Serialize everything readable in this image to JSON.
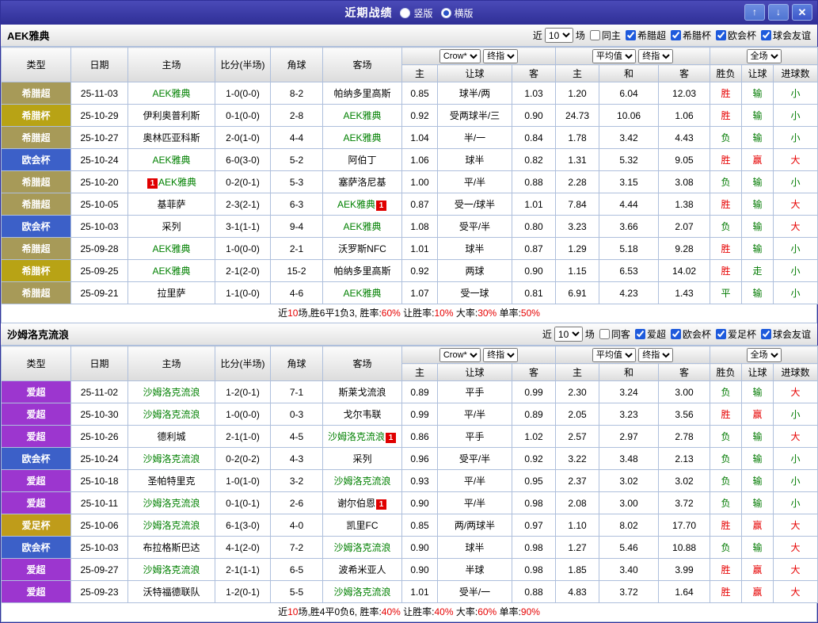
{
  "titlebar": {
    "title": "近期战绩",
    "radios": [
      {
        "label": "竖版",
        "selected": false
      },
      {
        "label": "横版",
        "selected": true
      }
    ],
    "icons": {
      "up": "↑",
      "down": "↓",
      "close": "✕"
    }
  },
  "colors": {
    "league": {
      "希腊超": "#a79a58",
      "希腊杯": "#b8a315",
      "欧会杯": "#3c60c8",
      "爱超": "#9c36cf",
      "爱足杯": "#bf9c1a"
    },
    "result": {
      "red": "#e60000",
      "green": "#007a00"
    }
  },
  "table_header": {
    "type": "类型",
    "date": "日期",
    "home": "主场",
    "score": "比分(半场)",
    "corner": "角球",
    "away": "客场",
    "crow_select": "Crow*",
    "final_select": "终指",
    "avg_select": "平均值",
    "final_select2": "终指",
    "scope_select": "全场",
    "h_home": "主",
    "h_handicap": "让球",
    "h_away": "客",
    "a_home": "主",
    "a_draw": "和",
    "a_away": "客",
    "r_result": "胜负",
    "r_handicap": "让球",
    "r_goals": "进球数"
  },
  "sections": [
    {
      "team": "AEK雅典",
      "filter": {
        "near": "近",
        "count": "10",
        "games": "场",
        "same": "同主",
        "same_checked": false,
        "leagues": [
          {
            "label": "希腊超",
            "checked": true
          },
          {
            "label": "希腊杯",
            "checked": true
          },
          {
            "label": "欧会杯",
            "checked": true
          },
          {
            "label": "球会友谊",
            "checked": true
          }
        ]
      },
      "rows": [
        {
          "lg": "希腊超",
          "dt": "25-11-03",
          "home": {
            "n": "AEK雅典",
            "g": 1
          },
          "sc": "1-0(0-0)",
          "cn": "8-2",
          "away": {
            "n": "帕纳多里高斯"
          },
          "odds": [
            "0.85",
            "球半/两",
            "1.03",
            "1.20",
            "6.04",
            "12.03"
          ],
          "res": [
            [
              "胜",
              "r"
            ],
            [
              "输",
              "g"
            ],
            [
              "小",
              "g"
            ]
          ]
        },
        {
          "lg": "希腊杯",
          "dt": "25-10-29",
          "home": {
            "n": "伊利奥普利斯"
          },
          "sc": "0-1(0-0)",
          "cn": "2-8",
          "away": {
            "n": "AEK雅典",
            "g": 1
          },
          "odds": [
            "0.92",
            "受两球半/三",
            "0.90",
            "24.73",
            "10.06",
            "1.06"
          ],
          "res": [
            [
              "胜",
              "r"
            ],
            [
              "输",
              "g"
            ],
            [
              "小",
              "g"
            ]
          ]
        },
        {
          "lg": "希腊超",
          "dt": "25-10-27",
          "home": {
            "n": "奥林匹亚科斯"
          },
          "sc": "2-0(1-0)",
          "cn": "4-4",
          "away": {
            "n": "AEK雅典",
            "g": 1
          },
          "odds": [
            "1.04",
            "半/一",
            "0.84",
            "1.78",
            "3.42",
            "4.43"
          ],
          "res": [
            [
              "负",
              "g"
            ],
            [
              "输",
              "g"
            ],
            [
              "小",
              "g"
            ]
          ]
        },
        {
          "lg": "欧会杯",
          "dt": "25-10-24",
          "home": {
            "n": "AEK雅典",
            "g": 1
          },
          "sc": "6-0(3-0)",
          "cn": "5-2",
          "away": {
            "n": "阿伯丁"
          },
          "odds": [
            "1.06",
            "球半",
            "0.82",
            "1.31",
            "5.32",
            "9.05"
          ],
          "res": [
            [
              "胜",
              "r"
            ],
            [
              "赢",
              "r"
            ],
            [
              "大",
              "r"
            ]
          ]
        },
        {
          "lg": "希腊超",
          "dt": "25-10-20",
          "home": {
            "n": "AEK雅典",
            "g": 1,
            "b": "1",
            "bp": "before"
          },
          "sc": "0-2(0-1)",
          "cn": "5-3",
          "away": {
            "n": "塞萨洛尼基"
          },
          "odds": [
            "1.00",
            "平/半",
            "0.88",
            "2.28",
            "3.15",
            "3.08"
          ],
          "res": [
            [
              "负",
              "g"
            ],
            [
              "输",
              "g"
            ],
            [
              "小",
              "g"
            ]
          ]
        },
        {
          "lg": "希腊超",
          "dt": "25-10-05",
          "home": {
            "n": "基菲萨"
          },
          "sc": "2-3(2-1)",
          "cn": "6-3",
          "away": {
            "n": "AEK雅典",
            "g": 1,
            "b": "1",
            "bp": "after"
          },
          "odds": [
            "0.87",
            "受一/球半",
            "1.01",
            "7.84",
            "4.44",
            "1.38"
          ],
          "res": [
            [
              "胜",
              "r"
            ],
            [
              "输",
              "g"
            ],
            [
              "大",
              "r"
            ]
          ]
        },
        {
          "lg": "欧会杯",
          "dt": "25-10-03",
          "home": {
            "n": "采列"
          },
          "sc": "3-1(1-1)",
          "cn": "9-4",
          "away": {
            "n": "AEK雅典",
            "g": 1
          },
          "odds": [
            "1.08",
            "受平/半",
            "0.80",
            "3.23",
            "3.66",
            "2.07"
          ],
          "res": [
            [
              "负",
              "g"
            ],
            [
              "输",
              "g"
            ],
            [
              "大",
              "r"
            ]
          ]
        },
        {
          "lg": "希腊超",
          "dt": "25-09-28",
          "home": {
            "n": "AEK雅典",
            "g": 1
          },
          "sc": "1-0(0-0)",
          "cn": "2-1",
          "away": {
            "n": "沃罗斯NFC"
          },
          "odds": [
            "1.01",
            "球半",
            "0.87",
            "1.29",
            "5.18",
            "9.28"
          ],
          "res": [
            [
              "胜",
              "r"
            ],
            [
              "输",
              "g"
            ],
            [
              "小",
              "g"
            ]
          ]
        },
        {
          "lg": "希腊杯",
          "dt": "25-09-25",
          "home": {
            "n": "AEK雅典",
            "g": 1
          },
          "sc": "2-1(2-0)",
          "cn": "15-2",
          "away": {
            "n": "帕纳多里高斯"
          },
          "odds": [
            "0.92",
            "两球",
            "0.90",
            "1.15",
            "6.53",
            "14.02"
          ],
          "res": [
            [
              "胜",
              "r"
            ],
            [
              "走",
              "g"
            ],
            [
              "小",
              "g"
            ]
          ]
        },
        {
          "lg": "希腊超",
          "dt": "25-09-21",
          "home": {
            "n": "拉里萨"
          },
          "sc": "1-1(0-0)",
          "cn": "4-6",
          "away": {
            "n": "AEK雅典",
            "g": 1
          },
          "odds": [
            "1.07",
            "受一球",
            "0.81",
            "6.91",
            "4.23",
            "1.43"
          ],
          "res": [
            [
              "平",
              "g"
            ],
            [
              "输",
              "g"
            ],
            [
              "小",
              "g"
            ]
          ]
        }
      ],
      "summary": [
        [
          "近",
          "k"
        ],
        [
          "10",
          "r"
        ],
        [
          "场,胜6平1负3, 胜率:",
          "k"
        ],
        [
          "60%",
          "r"
        ],
        [
          " 让胜率:",
          "k"
        ],
        [
          "10%",
          "r"
        ],
        [
          " 大率:",
          "k"
        ],
        [
          "30%",
          "r"
        ],
        [
          " 单率:",
          "k"
        ],
        [
          "50%",
          "r"
        ]
      ]
    },
    {
      "team": "沙姆洛克流浪",
      "filter": {
        "near": "近",
        "count": "10",
        "games": "场",
        "same": "同客",
        "same_checked": false,
        "leagues": [
          {
            "label": "爱超",
            "checked": true
          },
          {
            "label": "欧会杯",
            "checked": true
          },
          {
            "label": "爱足杯",
            "checked": true
          },
          {
            "label": "球会友谊",
            "checked": true
          }
        ]
      },
      "rows": [
        {
          "lg": "爱超",
          "dt": "25-11-02",
          "home": {
            "n": "沙姆洛克流浪",
            "g": 1
          },
          "sc": "1-2(0-1)",
          "cn": "7-1",
          "away": {
            "n": "斯莱戈流浪"
          },
          "odds": [
            "0.89",
            "平手",
            "0.99",
            "2.30",
            "3.24",
            "3.00"
          ],
          "res": [
            [
              "负",
              "g"
            ],
            [
              "输",
              "g"
            ],
            [
              "大",
              "r"
            ]
          ]
        },
        {
          "lg": "爱超",
          "dt": "25-10-30",
          "home": {
            "n": "沙姆洛克流浪",
            "g": 1
          },
          "sc": "1-0(0-0)",
          "cn": "0-3",
          "away": {
            "n": "戈尔韦联"
          },
          "odds": [
            "0.99",
            "平/半",
            "0.89",
            "2.05",
            "3.23",
            "3.56"
          ],
          "res": [
            [
              "胜",
              "r"
            ],
            [
              "赢",
              "r"
            ],
            [
              "小",
              "g"
            ]
          ]
        },
        {
          "lg": "爱超",
          "dt": "25-10-26",
          "home": {
            "n": "德利城"
          },
          "sc": "2-1(1-0)",
          "cn": "4-5",
          "away": {
            "n": "沙姆洛克流浪",
            "g": 1,
            "b": "1",
            "bp": "after"
          },
          "odds": [
            "0.86",
            "平手",
            "1.02",
            "2.57",
            "2.97",
            "2.78"
          ],
          "res": [
            [
              "负",
              "g"
            ],
            [
              "输",
              "g"
            ],
            [
              "大",
              "r"
            ]
          ]
        },
        {
          "lg": "欧会杯",
          "dt": "25-10-24",
          "home": {
            "n": "沙姆洛克流浪",
            "g": 1
          },
          "sc": "0-2(0-2)",
          "cn": "4-3",
          "away": {
            "n": "采列"
          },
          "odds": [
            "0.96",
            "受平/半",
            "0.92",
            "3.22",
            "3.48",
            "2.13"
          ],
          "res": [
            [
              "负",
              "g"
            ],
            [
              "输",
              "g"
            ],
            [
              "小",
              "g"
            ]
          ]
        },
        {
          "lg": "爱超",
          "dt": "25-10-18",
          "home": {
            "n": "圣帕特里克"
          },
          "sc": "1-0(1-0)",
          "cn": "3-2",
          "away": {
            "n": "沙姆洛克流浪",
            "g": 1
          },
          "odds": [
            "0.93",
            "平/半",
            "0.95",
            "2.37",
            "3.02",
            "3.02"
          ],
          "res": [
            [
              "负",
              "g"
            ],
            [
              "输",
              "g"
            ],
            [
              "小",
              "g"
            ]
          ]
        },
        {
          "lg": "爱超",
          "dt": "25-10-11",
          "home": {
            "n": "沙姆洛克流浪",
            "g": 1
          },
          "sc": "0-1(0-1)",
          "cn": "2-6",
          "away": {
            "n": "谢尔伯恩",
            "b": "1",
            "bp": "after"
          },
          "odds": [
            "0.90",
            "平/半",
            "0.98",
            "2.08",
            "3.00",
            "3.72"
          ],
          "res": [
            [
              "负",
              "g"
            ],
            [
              "输",
              "g"
            ],
            [
              "小",
              "g"
            ]
          ]
        },
        {
          "lg": "爱足杯",
          "dt": "25-10-06",
          "home": {
            "n": "沙姆洛克流浪",
            "g": 1
          },
          "sc": "6-1(3-0)",
          "cn": "4-0",
          "away": {
            "n": "凯里FC"
          },
          "odds": [
            "0.85",
            "两/两球半",
            "0.97",
            "1.10",
            "8.02",
            "17.70"
          ],
          "res": [
            [
              "胜",
              "r"
            ],
            [
              "赢",
              "r"
            ],
            [
              "大",
              "r"
            ]
          ]
        },
        {
          "lg": "欧会杯",
          "dt": "25-10-03",
          "home": {
            "n": "布拉格斯巴达"
          },
          "sc": "4-1(2-0)",
          "cn": "7-2",
          "away": {
            "n": "沙姆洛克流浪",
            "g": 1
          },
          "odds": [
            "0.90",
            "球半",
            "0.98",
            "1.27",
            "5.46",
            "10.88"
          ],
          "res": [
            [
              "负",
              "g"
            ],
            [
              "输",
              "g"
            ],
            [
              "大",
              "r"
            ]
          ]
        },
        {
          "lg": "爱超",
          "dt": "25-09-27",
          "home": {
            "n": "沙姆洛克流浪",
            "g": 1
          },
          "sc": "2-1(1-1)",
          "cn": "6-5",
          "away": {
            "n": "波希米亚人"
          },
          "odds": [
            "0.90",
            "半球",
            "0.98",
            "1.85",
            "3.40",
            "3.99"
          ],
          "res": [
            [
              "胜",
              "r"
            ],
            [
              "赢",
              "r"
            ],
            [
              "大",
              "r"
            ]
          ]
        },
        {
          "lg": "爱超",
          "dt": "25-09-23",
          "home": {
            "n": "沃特福德联队"
          },
          "sc": "1-2(0-1)",
          "cn": "5-5",
          "away": {
            "n": "沙姆洛克流浪",
            "g": 1
          },
          "odds": [
            "1.01",
            "受半/一",
            "0.88",
            "4.83",
            "3.72",
            "1.64"
          ],
          "res": [
            [
              "胜",
              "r"
            ],
            [
              "赢",
              "r"
            ],
            [
              "大",
              "r"
            ]
          ]
        }
      ],
      "summary": [
        [
          "近",
          "k"
        ],
        [
          "10",
          "r"
        ],
        [
          "场,胜4平0负6, 胜率:",
          "k"
        ],
        [
          "40%",
          "r"
        ],
        [
          " 让胜率:",
          "k"
        ],
        [
          "40%",
          "r"
        ],
        [
          " 大率:",
          "k"
        ],
        [
          "60%",
          "r"
        ],
        [
          " 单率:",
          "k"
        ],
        [
          "90%",
          "r"
        ]
      ]
    }
  ]
}
